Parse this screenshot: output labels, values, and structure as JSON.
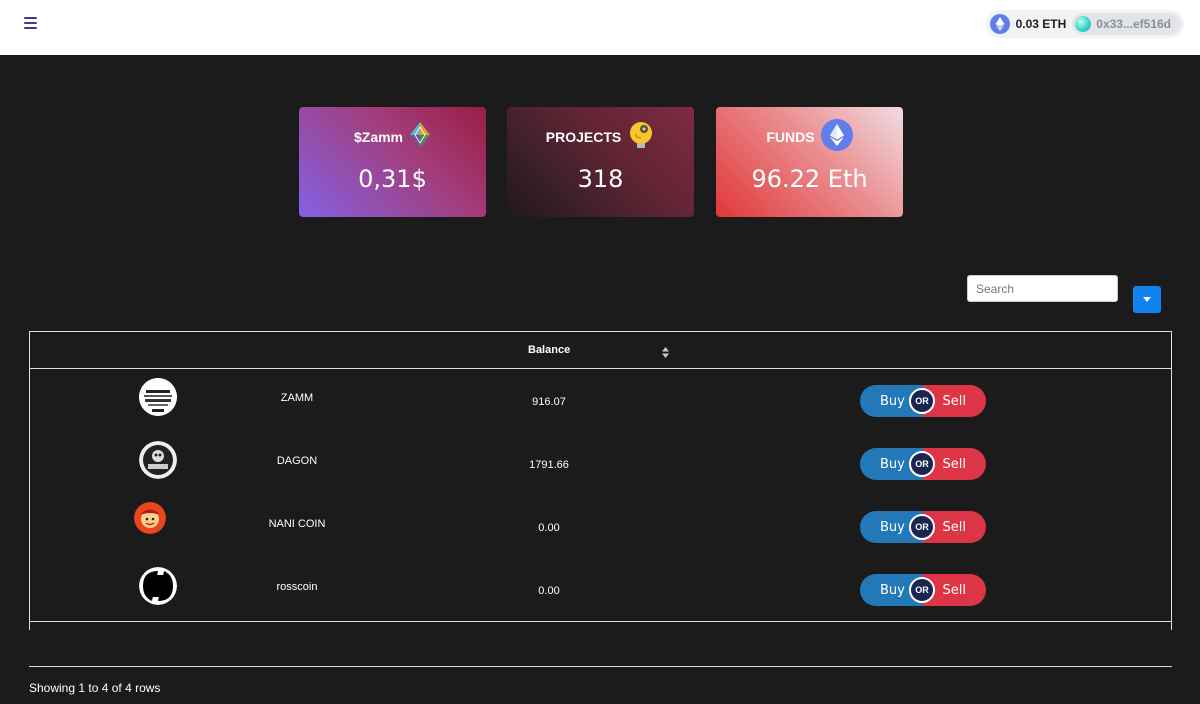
{
  "header": {
    "eth_balance": "0.03 ETH",
    "address": "0x33...ef516d"
  },
  "cards": [
    {
      "title": "$Zamm",
      "value": "0,31$",
      "icon": "zamm-gem-icon"
    },
    {
      "title": "PROJECTS",
      "value": "318",
      "icon": "lightbulb-icon"
    },
    {
      "title": "FUNDS",
      "value": "96.22 Eth",
      "icon": "ethereum-icon"
    }
  ],
  "search": {
    "placeholder": "Search"
  },
  "table": {
    "columns": {
      "balance": "Balance"
    },
    "rows": [
      {
        "name": "ZAMM",
        "balance": "916.07"
      },
      {
        "name": "DAGON",
        "balance": "1791.66"
      },
      {
        "name": "NANI COIN",
        "balance": "0.00"
      },
      {
        "name": "rosscoin",
        "balance": "0.00"
      }
    ],
    "buy_label": "Buy",
    "or_label": "OR",
    "sell_label": "Sell"
  },
  "footer": {
    "pagination": "Showing 1 to 4 of 4 rows"
  },
  "colors": {
    "buy": "#2379b7",
    "sell": "#dc3545",
    "accent": "#1183f0",
    "background": "#1b1b1b"
  }
}
